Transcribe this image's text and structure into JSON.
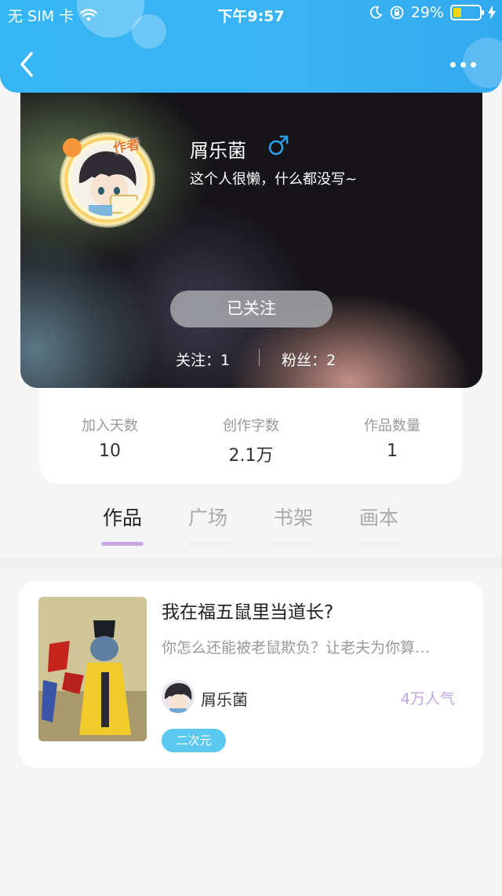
{
  "status_bar": {
    "carrier": "无 SIM 卡",
    "time": "下午9:57",
    "battery": "29%"
  },
  "profile": {
    "username": "屑乐菌",
    "bio": "这个人很懒，什么都没写~",
    "author_badge": "作者",
    "follow_button": "已关注",
    "following_label": "关注：1",
    "fans_label": "粉丝：2"
  },
  "stats": [
    {
      "label": "加入天数",
      "value": "10"
    },
    {
      "label": "创作字数",
      "value": "2.1万"
    },
    {
      "label": "作品数量",
      "value": "1"
    }
  ],
  "tabs": [
    {
      "label": "作品",
      "active": true
    },
    {
      "label": "广场",
      "active": false
    },
    {
      "label": "书架",
      "active": false
    },
    {
      "label": "画本",
      "active": false
    }
  ],
  "work": {
    "title": "我在福五鼠里当道长?",
    "description": "你怎么还能被老鼠欺负？让老夫为你算…",
    "author": "屑乐菌",
    "popularity": "4万人气",
    "tag": "二次元"
  },
  "colors": {
    "header_blue": "#36b6f4",
    "tab_active_bar": "#c9a8e6",
    "popularity": "#c5a6e6",
    "tag_blue": "#5bc8f0",
    "male_icon": "#2b9fe6"
  }
}
